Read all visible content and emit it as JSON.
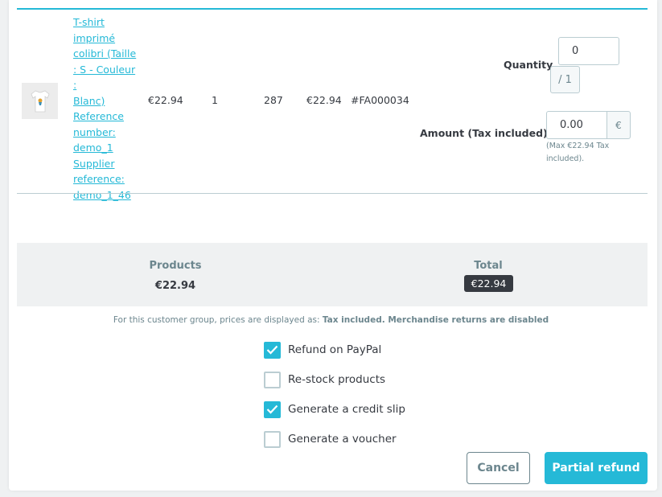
{
  "product": {
    "name_lines": [
      "T-shirt",
      "imprimé",
      "colibri (Taille",
      ": S - Couleur :",
      "Blanc)",
      "Reference",
      "number:",
      "demo_1",
      "Supplier",
      "reference:",
      "demo_1_46"
    ],
    "unit_price": "€22.94",
    "quantity": "1",
    "stock": "287",
    "total": "€22.94",
    "invoice": "#FA000034"
  },
  "refund": {
    "quantity_label": "Quantity",
    "quantity_value": "0",
    "quantity_suffix": "/ 1",
    "amount_label": "Amount (Tax included)",
    "amount_value": "0.00",
    "amount_currency": "€",
    "amount_help": "(Max €22.94 Tax included)."
  },
  "summary": {
    "products_label": "Products",
    "products_value": "€22.94",
    "total_label": "Total",
    "total_value": "€22.94"
  },
  "note": {
    "prefix": "For this customer group, prices are displayed as: ",
    "tax": "Tax included",
    "returns": ". Merchandise returns are disabled"
  },
  "options": [
    {
      "label": "Refund on PayPal",
      "checked": true
    },
    {
      "label": "Re-stock products",
      "checked": false
    },
    {
      "label": "Generate a credit slip",
      "checked": true
    },
    {
      "label": "Generate a voucher",
      "checked": false
    }
  ],
  "buttons": {
    "cancel": "Cancel",
    "partial_refund": "Partial refund"
  },
  "colors": {
    "accent": "#25b9d7",
    "dark": "#363a41",
    "muted": "#6c868e"
  }
}
